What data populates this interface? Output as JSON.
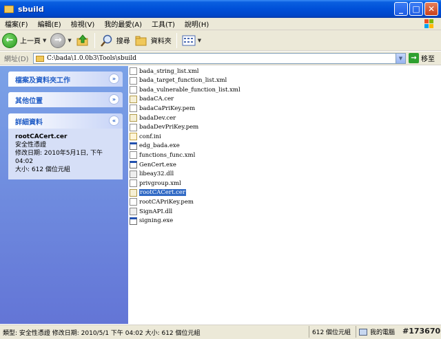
{
  "window": {
    "title": "sbuild"
  },
  "menubar": {
    "items": [
      "檔案(F)",
      "編輯(E)",
      "檢視(V)",
      "我的最愛(A)",
      "工具(T)",
      "說明(H)"
    ]
  },
  "toolbar": {
    "back_label": "上一頁",
    "search_label": "搜尋",
    "folders_label": "資料夾"
  },
  "address": {
    "label": "網址(D)",
    "value": "C:\\bada\\1.0.0b3\\Tools\\sbuild",
    "go_label": "移至"
  },
  "taskpane": {
    "file_tasks": "檔案及資料夾工作",
    "other_places": "其他位置",
    "details_title": "詳細資料",
    "details": {
      "name": "rootCACert.cer",
      "type": "安全性憑證",
      "modified": "修改日期: 2010年5月1日, 下午 04:02",
      "size": "大小: 612 個位元組"
    }
  },
  "files": [
    {
      "name": "bada_string_list.xml",
      "icon": "xml"
    },
    {
      "name": "bada_target_function_list.xml",
      "icon": "xml"
    },
    {
      "name": "bada_vulnerable_function_list.xml",
      "icon": "xml"
    },
    {
      "name": "badaCA.cer",
      "icon": "cert"
    },
    {
      "name": "badaCaPriKey.pem",
      "icon": "pem"
    },
    {
      "name": "badaDev.cer",
      "icon": "cert"
    },
    {
      "name": "badaDevPriKey.pem",
      "icon": "pem"
    },
    {
      "name": "conf.ini",
      "icon": "ini"
    },
    {
      "name": "edg_bada.exe",
      "icon": "exe"
    },
    {
      "name": "functions_func.xml",
      "icon": "xml"
    },
    {
      "name": "GenCert.exe",
      "icon": "exe"
    },
    {
      "name": "libeay32.dll",
      "icon": "dll"
    },
    {
      "name": "privgroup.xml",
      "icon": "xml"
    },
    {
      "name": "rootCACert.cer",
      "icon": "cert",
      "selected": true
    },
    {
      "name": "rootCAPriKey.pem",
      "icon": "pem"
    },
    {
      "name": "SignAPI.dll",
      "icon": "dll"
    },
    {
      "name": "signing.exe",
      "icon": "exe"
    }
  ],
  "statusbar": {
    "main": "類型: 安全性憑證 修改日期: 2010/5/1 下午 04:02 大小: 612 個位元組",
    "size": "612 個位元組",
    "location": "我的電腦"
  },
  "watermark": "#173670"
}
